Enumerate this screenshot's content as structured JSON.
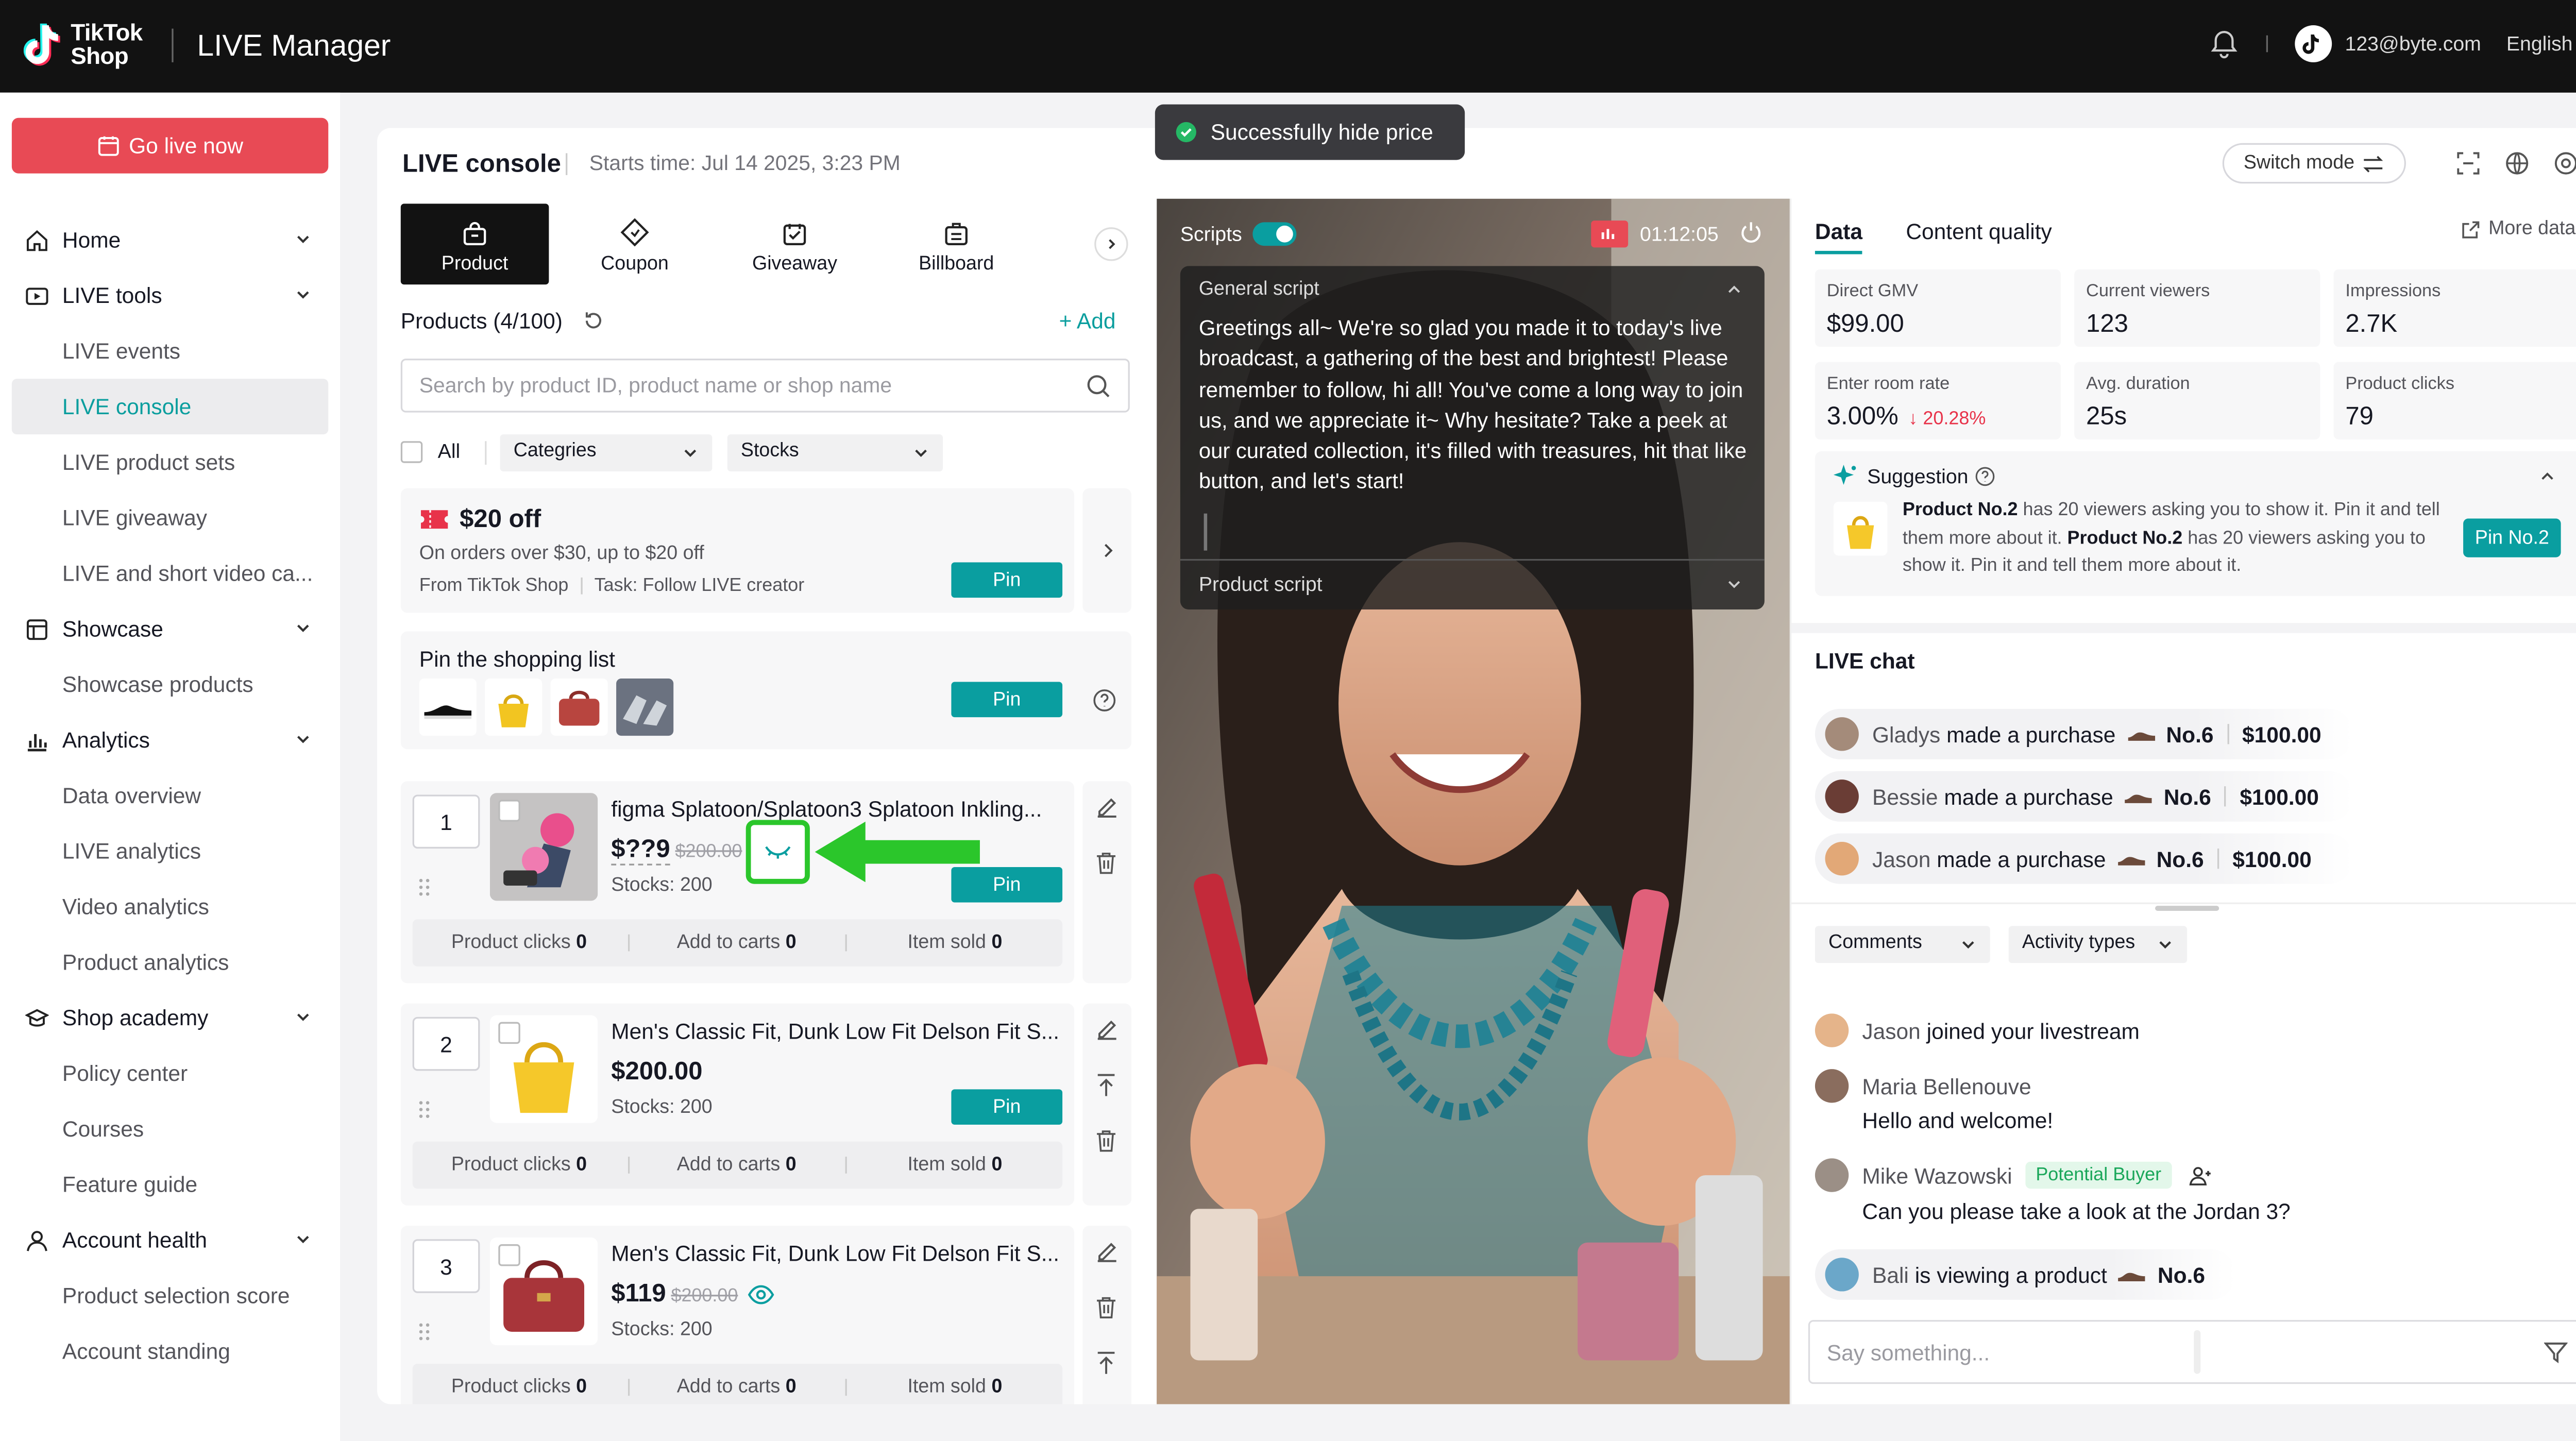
{
  "topbar": {
    "logo_line1": "TikTok",
    "logo_line2": "Shop",
    "app_title": "LIVE Manager",
    "user_email": "123@byte.com",
    "language": "English"
  },
  "sidebar": {
    "go_live": "Go live now",
    "items": [
      {
        "label": "Home",
        "type": "section",
        "icon": "home-icon"
      },
      {
        "label": "LIVE tools",
        "type": "section",
        "icon": "live-tools-icon"
      },
      {
        "label": "LIVE events",
        "type": "sub"
      },
      {
        "label": "LIVE console",
        "type": "sub",
        "active": true
      },
      {
        "label": "LIVE product sets",
        "type": "sub"
      },
      {
        "label": "LIVE giveaway",
        "type": "sub"
      },
      {
        "label": "LIVE and short video ca...",
        "type": "sub"
      },
      {
        "label": "Showcase",
        "type": "section",
        "icon": "showcase-icon"
      },
      {
        "label": "Showcase products",
        "type": "sub"
      },
      {
        "label": "Analytics",
        "type": "section",
        "icon": "analytics-icon"
      },
      {
        "label": "Data overview",
        "type": "sub"
      },
      {
        "label": "LIVE analytics",
        "type": "sub"
      },
      {
        "label": "Video analytics",
        "type": "sub"
      },
      {
        "label": "Product analytics",
        "type": "sub"
      },
      {
        "label": "Shop academy",
        "type": "section",
        "icon": "academy-icon"
      },
      {
        "label": "Policy center",
        "type": "sub"
      },
      {
        "label": "Courses",
        "type": "sub"
      },
      {
        "label": "Feature guide",
        "type": "sub"
      },
      {
        "label": "Account health",
        "type": "section",
        "icon": "account-icon"
      },
      {
        "label": "Product selection score",
        "type": "sub"
      },
      {
        "label": "Account standing",
        "type": "sub"
      }
    ]
  },
  "console": {
    "title": "LIVE console",
    "start_time": "Starts time: Jul 14 2025, 3:23 PM",
    "switch_mode": "Switch mode"
  },
  "toast": {
    "text": "Successfully hide price"
  },
  "tools": {
    "tabs": [
      "Product",
      "Coupon",
      "Giveaway",
      "Billboard"
    ],
    "products_label": "Products (4/100)",
    "add_label": "Add",
    "search_placeholder": "Search by product ID, product name or shop name",
    "all_label": "All",
    "categories_label": "Categries",
    "stocks_label": "Stocks"
  },
  "coupon": {
    "title": "$20 off",
    "desc": "On orders over $30, up to $20 off",
    "source": "From TikTok Shop",
    "task": "Task: Follow LIVE creator",
    "pin": "Pin"
  },
  "shopping_list": {
    "title": "Pin the shopping list",
    "pin": "Pin"
  },
  "products": [
    {
      "num": "1",
      "name": "figma Splatoon/Splatoon3 Splatoon Inkling...",
      "price": "$??9",
      "old_price": "$200.00",
      "stocks": "Stocks: 200",
      "pin": "Pin",
      "clicks_label": "Product clicks",
      "clicks": "0",
      "carts_label": "Add to carts",
      "carts": "0",
      "sold_label": "Item sold",
      "sold": "0"
    },
    {
      "num": "2",
      "name": "Men's Classic Fit, Dunk Low Fit Delson Fit S...",
      "price": "$200.00",
      "old_price": "",
      "stocks": "Stocks: 200",
      "pin": "Pin",
      "clicks_label": "Product clicks",
      "clicks": "0",
      "carts_label": "Add to carts",
      "carts": "0",
      "sold_label": "Item sold",
      "sold": "0"
    },
    {
      "num": "3",
      "name": "Men's Classic Fit, Dunk Low Fit Delson Fit S...",
      "price": "$119",
      "old_price": "$200.00",
      "stocks": "Stocks: 200",
      "pin": "",
      "clicks_label": "Product clicks",
      "clicks": "0",
      "carts_label": "Add to carts",
      "carts": "0",
      "sold_label": "Item sold",
      "sold": "0"
    }
  ],
  "video": {
    "scripts_label": "Scripts",
    "timer": "01:12:05",
    "general_script_title": "General script",
    "script_text": "Greetings all~ We're so glad you made it to today's live broadcast, a gathering of the best and brightest! Please remember to follow, hi all! You've come a long way to join us, and we appreciate it~ Why hesitate? Take a peek at our curated collection, it's filled with treasures, hit that like button, and let's start!",
    "product_script": "Product script"
  },
  "data_panel": {
    "tab_data": "Data",
    "tab_quality": "Content quality",
    "more_data": "More data",
    "stats": [
      {
        "label": "Direct GMV",
        "value": "$99.00"
      },
      {
        "label": "Current viewers",
        "value": "123"
      },
      {
        "label": "Impressions",
        "value": "2.7K"
      },
      {
        "label": "Enter room rate",
        "value": "3.00%",
        "delta": "20.28%"
      },
      {
        "label": "Avg. duration",
        "value": "25s"
      },
      {
        "label": "Product clicks",
        "value": "79"
      }
    ],
    "suggestion_title": "Suggestion",
    "suggestion_p1": "Product No.2",
    "suggestion_t1": " has 20 viewers asking you to show it. Pin it and tell them more about it. ",
    "suggestion_p2": "Product No.2",
    "suggestion_t2": " has 20 viewers asking you to show it. Pin it and tell them more about it.",
    "suggestion_btn": "Pin No.2"
  },
  "chat": {
    "title": "LIVE chat",
    "purchases": [
      {
        "name": "Gladys",
        "action": "made a purchase",
        "product": "No.6",
        "amount": "$100.00"
      },
      {
        "name": "Bessie",
        "action": "made a purchase",
        "product": "No.6",
        "amount": "$100.00"
      },
      {
        "name": "Jason",
        "action": "made a purchase",
        "product": "No.6",
        "amount": "$100.00"
      }
    ],
    "filter_comments": "Comments",
    "filter_activity": "Activity types",
    "joined_name": "Jason",
    "joined_text": "joined your livestream",
    "c1_name": "Maria Bellenouve",
    "c1_text": "Hello and welcome!",
    "c2_name": "Mike Wazowski",
    "c2_badge": "Potential Buyer",
    "c2_text": "Can you please take a look at the Jordan 3?",
    "view_name": "Bali",
    "view_text": "is viewing a product",
    "view_product": "No.6",
    "input_placeholder": "Say something..."
  },
  "colors": {
    "accent": "#0a9ea0",
    "golive": "#e84a55",
    "highlight": "#2bc62b"
  }
}
